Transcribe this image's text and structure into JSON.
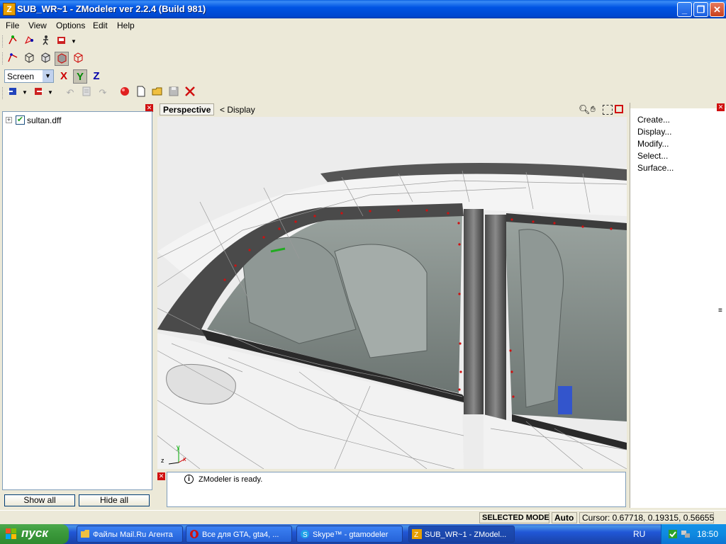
{
  "window": {
    "title": "SUB_WR~1 - ZModeler ver 2.2.4 (Build 981)"
  },
  "menu": {
    "items": [
      "File",
      "View",
      "Options",
      "Edit",
      "Help"
    ]
  },
  "toolbar": {
    "coord_mode": "Screen",
    "axis_x": "X",
    "axis_y": "Y",
    "axis_z": "Z"
  },
  "tree": {
    "items": [
      {
        "label": "sultan.dff",
        "checked": true,
        "expander": "+"
      }
    ]
  },
  "left_panel": {
    "show_all": "Show all",
    "hide_all": "Hide all"
  },
  "viewport": {
    "view_name": "Perspective",
    "display_label": "<  Display",
    "axis_y": "y",
    "axis_z": "z",
    "axis_x": "x"
  },
  "right_panel": {
    "items": [
      "Create...",
      "Display...",
      "Modify...",
      "Select...",
      "Surface..."
    ]
  },
  "log": {
    "message": "ZModeler is ready.",
    "info_glyph": "i"
  },
  "status": {
    "mode": "SELECTED MODE",
    "auto": "Auto",
    "cursor": "Cursor: 0.67718, 0.19315, 0.56655"
  },
  "taskbar": {
    "start_label": "пуск",
    "tasks": [
      {
        "label": "Файлы Mail.Ru Агента"
      },
      {
        "label": "Все для GTA, gta4, ..."
      },
      {
        "label": "Skype™ - gtamodeler"
      },
      {
        "label": "SUB_WR~1 - ZModel..."
      }
    ],
    "language": "RU",
    "clock": "18:50"
  },
  "colors": {
    "title_blue": "#0054e3",
    "taskbar_blue": "#245edb",
    "start_green": "#3c9a3c",
    "tray_blue": "#0f8ae0",
    "mesh_vertex_red": "#d01010"
  },
  "icons": [
    "app-icon",
    "minimize-icon",
    "restore-icon",
    "close-icon",
    "select-vertex-icon",
    "select-face-icon",
    "walk-icon",
    "object-icon",
    "vertex-mode-icon",
    "cube-icon",
    "cube-face-icon",
    "cube-object-icon",
    "cube-red-icon",
    "import-icon",
    "export-icon",
    "undo-icon",
    "clipboard-icon",
    "redo-icon",
    "render-sphere-icon",
    "new-file-icon",
    "open-folder-icon",
    "save-icon",
    "delete-icon",
    "zoom-icon",
    "pan-hand-icon",
    "fit-icon",
    "maximize-viewport-icon"
  ]
}
